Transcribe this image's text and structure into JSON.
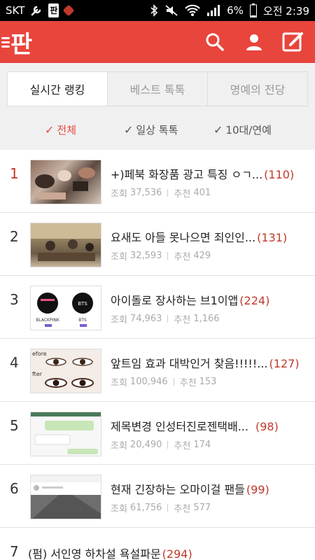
{
  "statusbar": {
    "carrier": "SKT",
    "battery": "6%",
    "time": "오전 2:39",
    "pan_badge": "판"
  },
  "app": {
    "logo": "판",
    "accent": "#e8453c",
    "rank_color": "#c0392b"
  },
  "tabs": [
    {
      "label": "실시간 랭킹",
      "active": true
    },
    {
      "label": "베스트 톡톡",
      "active": false
    },
    {
      "label": "명예의 전당",
      "active": false
    }
  ],
  "filters": [
    {
      "label": "전체",
      "active": true
    },
    {
      "label": "일상 톡톡",
      "active": false
    },
    {
      "label": "10대/연예",
      "active": false
    }
  ],
  "posts": [
    {
      "rank": "1",
      "title": "+)페북 화장품 광고 특징 ㅇㄱ...",
      "comments": "(110)",
      "views_label": "조회",
      "views": "37,536",
      "rec_label": "추천",
      "rec": "401"
    },
    {
      "rank": "2",
      "title": "요새도 아들 못나으면 죄인인...",
      "comments": "(131)",
      "views_label": "조회",
      "views": "32,593",
      "rec_label": "추천",
      "rec": "429"
    },
    {
      "rank": "3",
      "title": "아이돌로 장사하는 브1이앱",
      "comments": "(224)",
      "views_label": "조회",
      "views": "74,963",
      "rec_label": "추천",
      "rec": "1,166"
    },
    {
      "rank": "4",
      "title": "앞트임 효과 대박인거 찾음!!!!!...",
      "comments": "(127)",
      "views_label": "조회",
      "views": "100,946",
      "rec_label": "추천",
      "rec": "153"
    },
    {
      "rank": "5",
      "title": "제목변경 인성터진로젠택배...",
      "comments": "(98)",
      "views_label": "조회",
      "views": "20,490",
      "rec_label": "추천",
      "rec": "174"
    },
    {
      "rank": "6",
      "title": "현재 긴장하는 오마이걸 팬들",
      "comments": "(99)",
      "views_label": "조회",
      "views": "61,756",
      "rec_label": "추천",
      "rec": "577"
    },
    {
      "rank": "7",
      "title": "(펌) 서인영 하차설 욕설파문",
      "comments": "(294)"
    }
  ],
  "thumb_text": {
    "blackpink": "BLACKPINK",
    "bts_logo": "BTS",
    "bts": "BTS",
    "before": "efore",
    "after": "fter"
  }
}
